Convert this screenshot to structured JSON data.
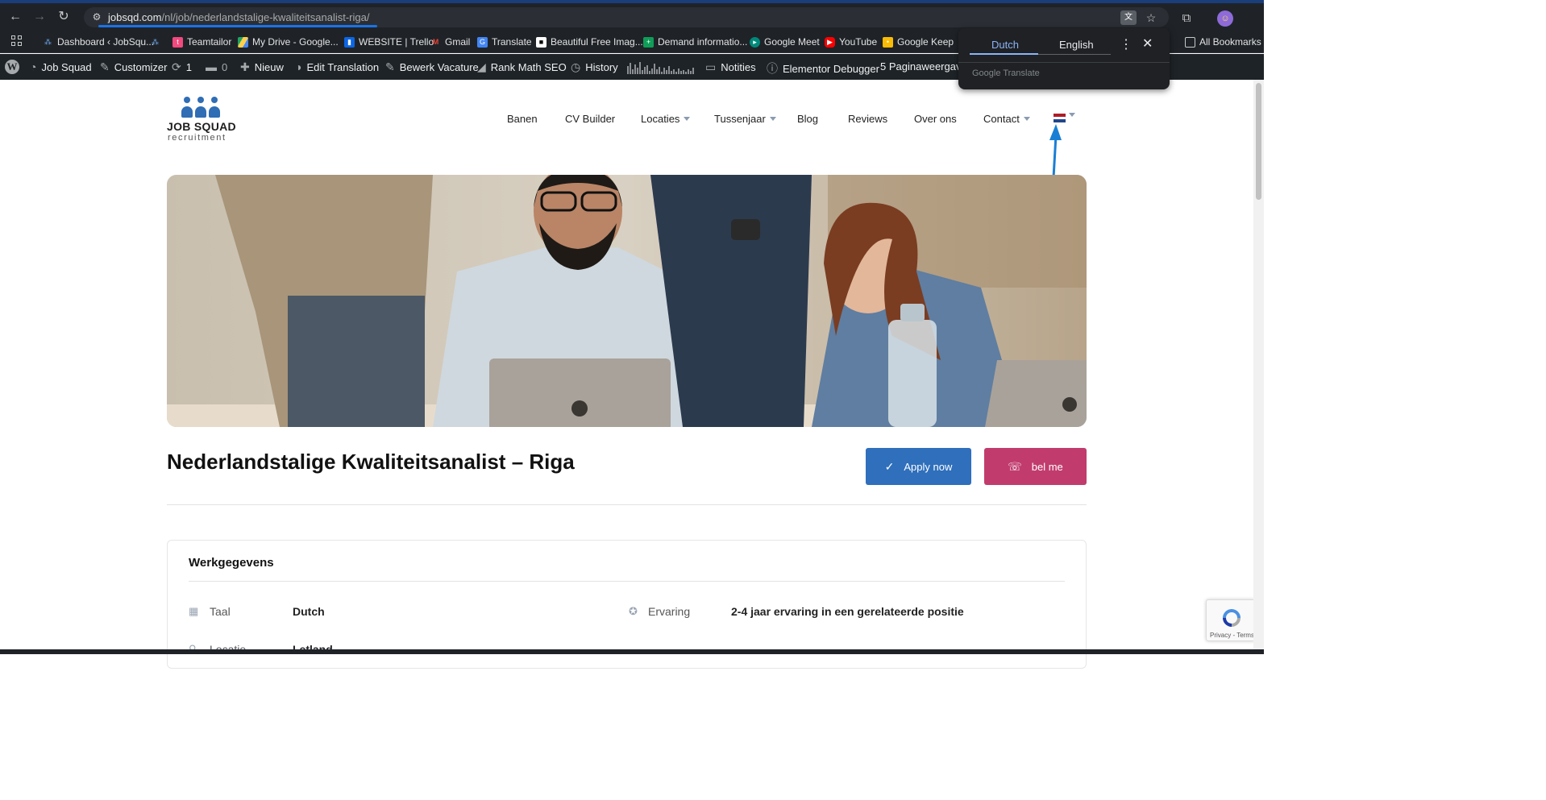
{
  "browser": {
    "url_domain": "jobsqd.com",
    "url_path": "/nl/job/nederlandstalige-kwaliteitsanalist-riga/",
    "accent_color": "#1a73e8",
    "bookmarks": [
      {
        "label": "Dashboard ‹ JobSqu...",
        "icon": "jobsquad-icon"
      },
      {
        "label": "",
        "icon": "jobsquad-icon"
      },
      {
        "label": "Teamtailor",
        "icon": "teamtailor-icon"
      },
      {
        "label": "My Drive - Google...",
        "icon": "drive-icon"
      },
      {
        "label": "WEBSITE | Trello",
        "icon": "trello-icon"
      },
      {
        "label": "Gmail",
        "icon": "gmail-icon"
      },
      {
        "label": "Translate",
        "icon": "translate-icon"
      },
      {
        "label": "Beautiful Free Imag...",
        "icon": "unsplash-icon"
      },
      {
        "label": "Demand informatio...",
        "icon": "sheets-icon"
      },
      {
        "label": "Google Meet",
        "icon": "meet-icon"
      },
      {
        "label": "YouTube",
        "icon": "youtube-icon"
      },
      {
        "label": "Google Keep",
        "icon": "keep-icon"
      }
    ],
    "all_bookmarks_label": "All Bookmarks"
  },
  "wp_admin_bar": {
    "site_name": "Job Squad",
    "customizer": "Customizer",
    "updates_count": "1",
    "comments_count": "0",
    "new": "Nieuw",
    "edit_translation": "Edit Translation",
    "edit_vacancy": "Bewerk Vacature",
    "rank_math": "Rank Math SEO",
    "history": "History",
    "notes": "Notities",
    "elementor_debugger": "Elementor Debugger",
    "page_views": "5 Paginaweergaven"
  },
  "translate_popup": {
    "tab_source": "Dutch",
    "tab_target": "English",
    "brand": "Google Translate"
  },
  "site": {
    "logo_title": "JOB SQUAD",
    "logo_subtitle": "recruitment",
    "brand_color": "#2f6db5",
    "menu": [
      {
        "label": "Banen",
        "dropdown": false
      },
      {
        "label": "CV Builder",
        "dropdown": false
      },
      {
        "label": "Locaties",
        "dropdown": true
      },
      {
        "label": "Tussenjaar",
        "dropdown": true
      },
      {
        "label": "Blog",
        "dropdown": false
      },
      {
        "label": "Reviews",
        "dropdown": false
      },
      {
        "label": "Over ons",
        "dropdown": false
      },
      {
        "label": "Contact",
        "dropdown": true
      }
    ],
    "language_flag": "netherlands-flag"
  },
  "job": {
    "title": "Nederlandstalige Kwaliteitsanalist – Riga",
    "apply_label": "Apply now",
    "call_label": "bel me",
    "apply_color": "#2f6fbc",
    "call_color": "#c13c6d"
  },
  "details": {
    "heading": "Werkgegevens",
    "rows": [
      {
        "label": "Taal",
        "value": "Dutch"
      },
      {
        "label": "Ervaring",
        "value": "2-4 jaar ervaring in een gerelateerde positie"
      },
      {
        "label": "Locatie",
        "value": "Letland"
      }
    ]
  },
  "recaptcha": {
    "text": "Privacy - Terms"
  }
}
